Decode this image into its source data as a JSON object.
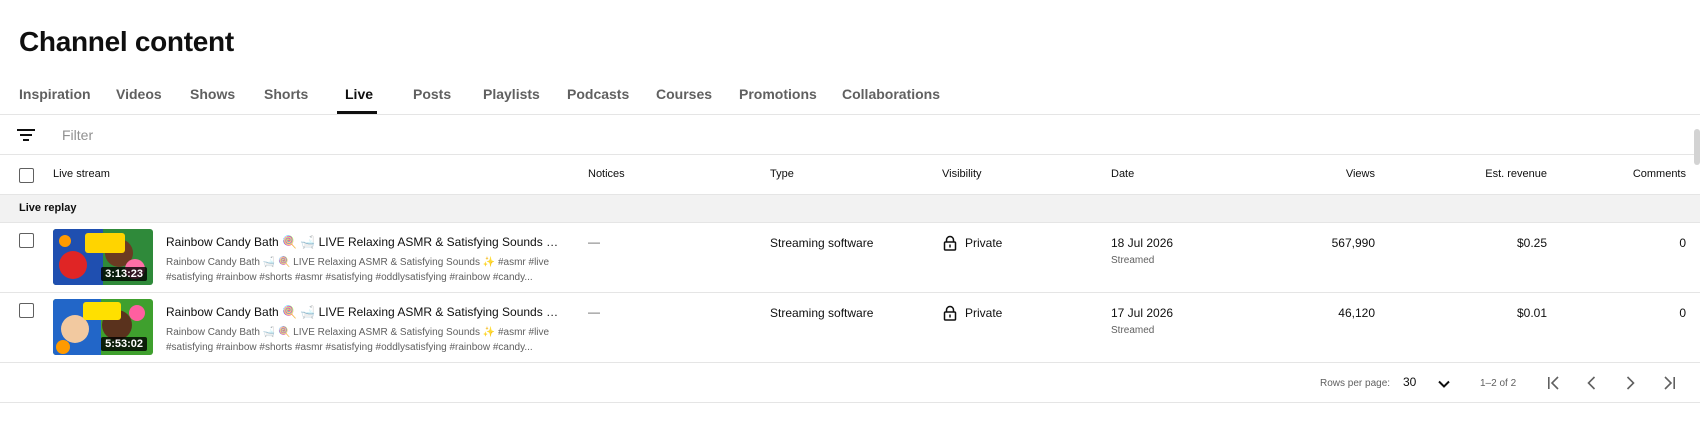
{
  "page": {
    "title": "Channel content"
  },
  "tabs": [
    {
      "label": "Inspiration"
    },
    {
      "label": "Videos"
    },
    {
      "label": "Shows"
    },
    {
      "label": "Shorts"
    },
    {
      "label": "Live"
    },
    {
      "label": "Posts"
    },
    {
      "label": "Playlists"
    },
    {
      "label": "Podcasts"
    },
    {
      "label": "Courses"
    },
    {
      "label": "Promotions"
    },
    {
      "label": "Collaborations"
    }
  ],
  "active_tab": "Live",
  "filter": {
    "placeholder": "Filter",
    "value": ""
  },
  "table": {
    "columns": {
      "stream": "Live stream",
      "notices": "Notices",
      "type": "Type",
      "visibility": "Visibility",
      "date": "Date",
      "views": "Views",
      "revenue": "Est. revenue",
      "comments": "Comments"
    },
    "group_label": "Live replay",
    "rows": [
      {
        "title": "Rainbow Candy Bath 🍭 🛁 LIVE Relaxing ASMR & Satisfying Sounds ✨ #asmr #live",
        "description": "Rainbow Candy Bath 🛁 🍭 LIVE Relaxing ASMR & Satisfying Sounds ✨ #asmr #live #satisfying #rainbow #shorts #asmr #satisfying #oddlysatisfying #rainbow #candy...",
        "duration": "3:13:23",
        "notices": "—",
        "type": "Streaming software",
        "visibility": "Private",
        "date": "18 Jul 2026",
        "date_sub": "Streamed",
        "views": "567,990",
        "revenue": "$0.25",
        "comments": "0"
      },
      {
        "title": "Rainbow Candy Bath 🍭 🛁 LIVE Relaxing ASMR & Satisfying Sounds ✨ #asmr #live",
        "description": "Rainbow Candy Bath 🛁 🍭 LIVE Relaxing ASMR & Satisfying Sounds ✨ #asmr #live #satisfying #rainbow #shorts #asmr #satisfying #oddlysatisfying #rainbow #candy...",
        "duration": "5:53:02",
        "notices": "—",
        "type": "Streaming software",
        "visibility": "Private",
        "date": "17 Jul 2026",
        "date_sub": "Streamed",
        "views": "46,120",
        "revenue": "$0.01",
        "comments": "0"
      }
    ]
  },
  "pagination": {
    "rows_per_page_label": "Rows per page:",
    "rows_per_page": "30",
    "range": "1–2 of 2"
  },
  "colors": {
    "text": "#0f0f0f",
    "secondary": "#606060",
    "divider": "#e5e5e5",
    "group_bg": "#f2f2f2"
  }
}
